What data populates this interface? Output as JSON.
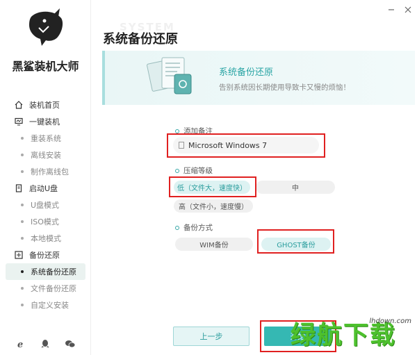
{
  "app": {
    "name": "黑鲨装机大师"
  },
  "window": {
    "minimize_icon": "minimize-icon",
    "close_icon": "close-icon"
  },
  "sidebar": {
    "items": [
      {
        "label": "装机首页",
        "type": "group",
        "icon": "home-icon"
      },
      {
        "label": "一键装机",
        "type": "group",
        "icon": "monitor-icon"
      },
      {
        "label": "重装系统",
        "type": "sub"
      },
      {
        "label": "离线安装",
        "type": "sub"
      },
      {
        "label": "制作离线包",
        "type": "sub"
      },
      {
        "label": "启动U盘",
        "type": "group",
        "icon": "usb-icon"
      },
      {
        "label": "U盘模式",
        "type": "sub"
      },
      {
        "label": "ISO模式",
        "type": "sub"
      },
      {
        "label": "本地模式",
        "type": "sub"
      },
      {
        "label": "备份还原",
        "type": "group",
        "icon": "backup-icon"
      },
      {
        "label": "系统备份还原",
        "type": "sub",
        "active": true
      },
      {
        "label": "文件备份还原",
        "type": "sub"
      },
      {
        "label": "自定义安装",
        "type": "sub"
      }
    ],
    "bottom_icons": [
      "ie-icon",
      "qq-icon",
      "wechat-icon"
    ]
  },
  "page": {
    "title": "系统备份还原",
    "title_watermark": "SYSTEM"
  },
  "banner": {
    "title": "系统备份还原",
    "subtitle": "告别系统因长期使用导致卡又慢的烦恼！"
  },
  "remark": {
    "label": "添加备注",
    "value": "Microsoft Windows 7"
  },
  "compression": {
    "label": "压缩等级",
    "options": [
      "低（文件大，速度快）",
      "中",
      "高（文件小，速度慢）"
    ],
    "selected": "低（文件大，速度快）"
  },
  "backup_method": {
    "label": "备份方式",
    "options": [
      "WIM备份",
      "GHOST备份"
    ],
    "selected": "GHOST备份"
  },
  "buttons": {
    "prev": "上一步",
    "start": "开始"
  },
  "watermark": {
    "text": "绿航下载",
    "domain": "lhdown.com"
  },
  "colors": {
    "accent": "#35b8b3",
    "highlight": "#e02020",
    "watermark": "#4ec12e"
  }
}
